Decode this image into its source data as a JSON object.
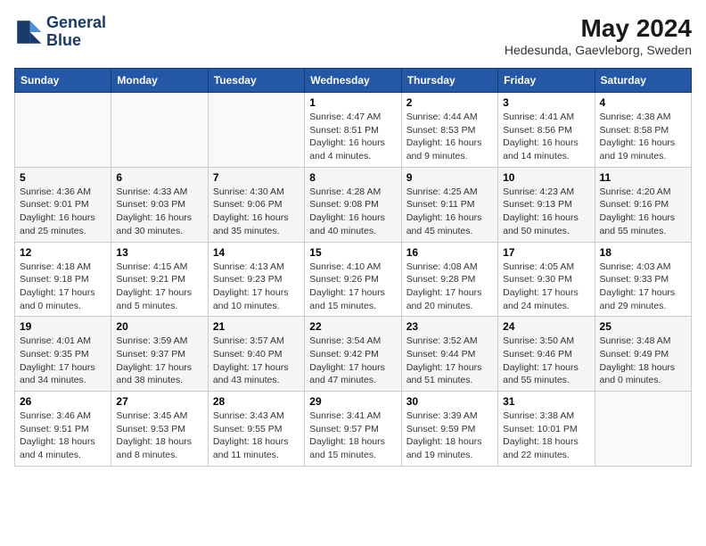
{
  "header": {
    "logo_line1": "General",
    "logo_line2": "Blue",
    "title": "May 2024",
    "subtitle": "Hedesunda, Gaevleborg, Sweden"
  },
  "weekdays": [
    "Sunday",
    "Monday",
    "Tuesday",
    "Wednesday",
    "Thursday",
    "Friday",
    "Saturday"
  ],
  "weeks": [
    [
      {
        "day": "",
        "info": ""
      },
      {
        "day": "",
        "info": ""
      },
      {
        "day": "",
        "info": ""
      },
      {
        "day": "1",
        "info": "Sunrise: 4:47 AM\nSunset: 8:51 PM\nDaylight: 16 hours\nand 4 minutes."
      },
      {
        "day": "2",
        "info": "Sunrise: 4:44 AM\nSunset: 8:53 PM\nDaylight: 16 hours\nand 9 minutes."
      },
      {
        "day": "3",
        "info": "Sunrise: 4:41 AM\nSunset: 8:56 PM\nDaylight: 16 hours\nand 14 minutes."
      },
      {
        "day": "4",
        "info": "Sunrise: 4:38 AM\nSunset: 8:58 PM\nDaylight: 16 hours\nand 19 minutes."
      }
    ],
    [
      {
        "day": "5",
        "info": "Sunrise: 4:36 AM\nSunset: 9:01 PM\nDaylight: 16 hours\nand 25 minutes."
      },
      {
        "day": "6",
        "info": "Sunrise: 4:33 AM\nSunset: 9:03 PM\nDaylight: 16 hours\nand 30 minutes."
      },
      {
        "day": "7",
        "info": "Sunrise: 4:30 AM\nSunset: 9:06 PM\nDaylight: 16 hours\nand 35 minutes."
      },
      {
        "day": "8",
        "info": "Sunrise: 4:28 AM\nSunset: 9:08 PM\nDaylight: 16 hours\nand 40 minutes."
      },
      {
        "day": "9",
        "info": "Sunrise: 4:25 AM\nSunset: 9:11 PM\nDaylight: 16 hours\nand 45 minutes."
      },
      {
        "day": "10",
        "info": "Sunrise: 4:23 AM\nSunset: 9:13 PM\nDaylight: 16 hours\nand 50 minutes."
      },
      {
        "day": "11",
        "info": "Sunrise: 4:20 AM\nSunset: 9:16 PM\nDaylight: 16 hours\nand 55 minutes."
      }
    ],
    [
      {
        "day": "12",
        "info": "Sunrise: 4:18 AM\nSunset: 9:18 PM\nDaylight: 17 hours\nand 0 minutes."
      },
      {
        "day": "13",
        "info": "Sunrise: 4:15 AM\nSunset: 9:21 PM\nDaylight: 17 hours\nand 5 minutes."
      },
      {
        "day": "14",
        "info": "Sunrise: 4:13 AM\nSunset: 9:23 PM\nDaylight: 17 hours\nand 10 minutes."
      },
      {
        "day": "15",
        "info": "Sunrise: 4:10 AM\nSunset: 9:26 PM\nDaylight: 17 hours\nand 15 minutes."
      },
      {
        "day": "16",
        "info": "Sunrise: 4:08 AM\nSunset: 9:28 PM\nDaylight: 17 hours\nand 20 minutes."
      },
      {
        "day": "17",
        "info": "Sunrise: 4:05 AM\nSunset: 9:30 PM\nDaylight: 17 hours\nand 24 minutes."
      },
      {
        "day": "18",
        "info": "Sunrise: 4:03 AM\nSunset: 9:33 PM\nDaylight: 17 hours\nand 29 minutes."
      }
    ],
    [
      {
        "day": "19",
        "info": "Sunrise: 4:01 AM\nSunset: 9:35 PM\nDaylight: 17 hours\nand 34 minutes."
      },
      {
        "day": "20",
        "info": "Sunrise: 3:59 AM\nSunset: 9:37 PM\nDaylight: 17 hours\nand 38 minutes."
      },
      {
        "day": "21",
        "info": "Sunrise: 3:57 AM\nSunset: 9:40 PM\nDaylight: 17 hours\nand 43 minutes."
      },
      {
        "day": "22",
        "info": "Sunrise: 3:54 AM\nSunset: 9:42 PM\nDaylight: 17 hours\nand 47 minutes."
      },
      {
        "day": "23",
        "info": "Sunrise: 3:52 AM\nSunset: 9:44 PM\nDaylight: 17 hours\nand 51 minutes."
      },
      {
        "day": "24",
        "info": "Sunrise: 3:50 AM\nSunset: 9:46 PM\nDaylight: 17 hours\nand 55 minutes."
      },
      {
        "day": "25",
        "info": "Sunrise: 3:48 AM\nSunset: 9:49 PM\nDaylight: 18 hours\nand 0 minutes."
      }
    ],
    [
      {
        "day": "26",
        "info": "Sunrise: 3:46 AM\nSunset: 9:51 PM\nDaylight: 18 hours\nand 4 minutes."
      },
      {
        "day": "27",
        "info": "Sunrise: 3:45 AM\nSunset: 9:53 PM\nDaylight: 18 hours\nand 8 minutes."
      },
      {
        "day": "28",
        "info": "Sunrise: 3:43 AM\nSunset: 9:55 PM\nDaylight: 18 hours\nand 11 minutes."
      },
      {
        "day": "29",
        "info": "Sunrise: 3:41 AM\nSunset: 9:57 PM\nDaylight: 18 hours\nand 15 minutes."
      },
      {
        "day": "30",
        "info": "Sunrise: 3:39 AM\nSunset: 9:59 PM\nDaylight: 18 hours\nand 19 minutes."
      },
      {
        "day": "31",
        "info": "Sunrise: 3:38 AM\nSunset: 10:01 PM\nDaylight: 18 hours\nand 22 minutes."
      },
      {
        "day": "",
        "info": ""
      }
    ]
  ]
}
